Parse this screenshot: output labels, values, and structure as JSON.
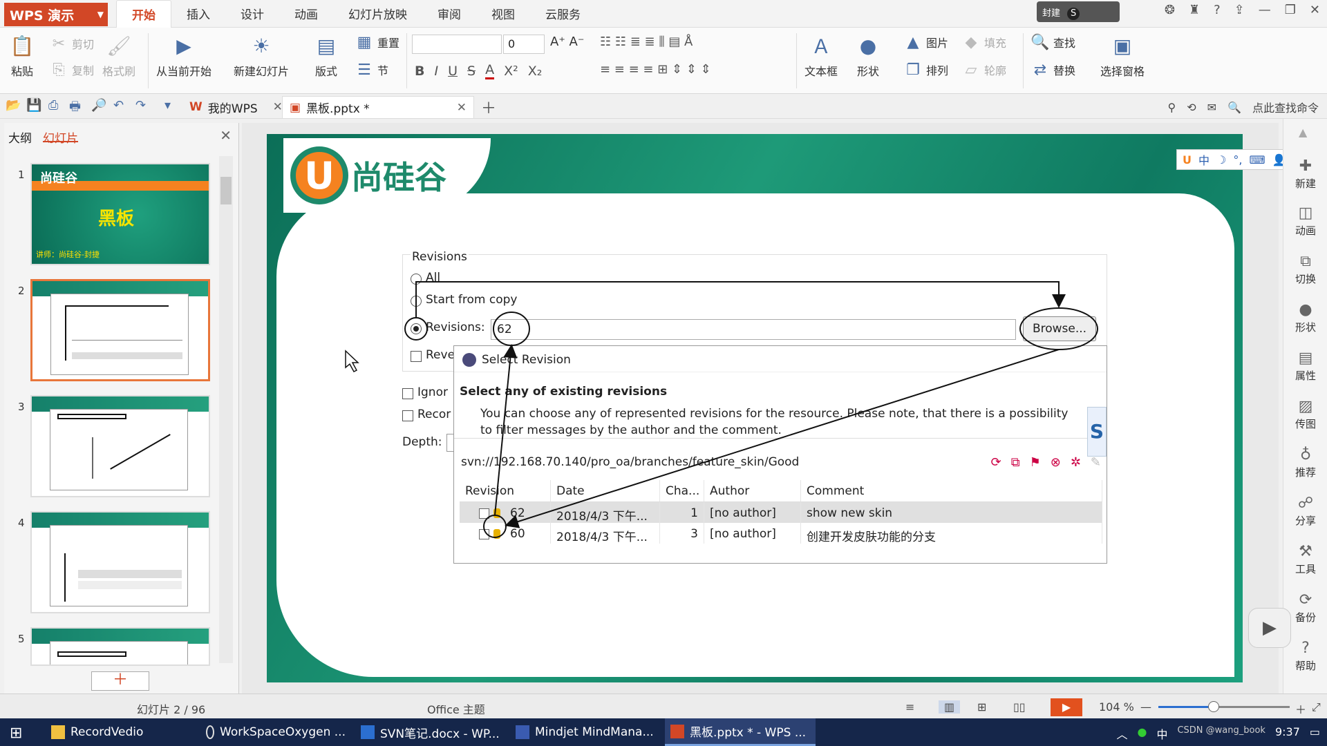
{
  "app": {
    "name": "WPS 演示",
    "user": "封建",
    "coin": "S"
  },
  "menu": {
    "tabs": [
      "开始",
      "插入",
      "设计",
      "动画",
      "幻灯片放映",
      "审阅",
      "视图",
      "云服务"
    ],
    "active": 0
  },
  "ribbon": {
    "paste": "粘贴",
    "cut": "剪切",
    "copy": "复制",
    "format_painter": "格式刷",
    "from_current": "从当前开始",
    "new_slide": "新建幻灯片",
    "layout": "版式",
    "reset": "重置",
    "section": "节",
    "font_size": "0",
    "textbox": "文本框",
    "shape": "形状",
    "picture": "图片",
    "fill": "填充",
    "arrange": "排列",
    "outline": "轮廓",
    "find": "查找",
    "replace": "替换",
    "select_pane": "选择窗格"
  },
  "doc_tabs": [
    {
      "label": "我的WPS",
      "active": false
    },
    {
      "label": "黑板.pptx *",
      "active": true
    }
  ],
  "quick_search": "点此查找命令",
  "left_panel": {
    "tab_outline": "大纲",
    "tab_slides": "幻灯片",
    "thumb_numbers": [
      "1",
      "2",
      "3",
      "4",
      "5"
    ],
    "thumb1": {
      "brand": "尚硅谷",
      "title": "黑板",
      "author": "讲师：尚硅谷-封捷"
    }
  },
  "slide": {
    "brand": "尚硅谷",
    "u": "U",
    "revisions_group": "Revisions",
    "opt_all": "All",
    "opt_start": "Start from copy",
    "opt_revisions": "Revisions:",
    "revisions_value": "62",
    "browse": "Browse...",
    "reve": "Reve",
    "ignor": "Ignor",
    "recor": "Recor",
    "depth": "Depth:",
    "select_revision": {
      "title": "Select Revision",
      "heading": "Select any of existing revisions",
      "desc1": "You can choose any of represented revisions for the resource. Please note, that there is a possibility",
      "desc2": "to filter messages by the author and the comment.",
      "badge": "S",
      "url": "svn://192.168.70.140/pro_oa/branches/feature_skin/Good",
      "columns": [
        "Revision",
        "Date",
        "Cha...",
        "Author",
        "Comment"
      ],
      "rows": [
        {
          "rev": "62",
          "date": "2018/4/3 下午...",
          "changes": "1",
          "author": "[no author]",
          "comment": "show new skin"
        },
        {
          "rev": "60",
          "date": "2018/4/3 下午...",
          "changes": "3",
          "author": "[no author]",
          "comment": "创建开发皮肤功能的分支"
        }
      ]
    }
  },
  "right_bar": [
    "新建",
    "动画",
    "切换",
    "形状",
    "属性",
    "传图",
    "推荐",
    "分享",
    "工具",
    "备份",
    "帮助"
  ],
  "status": {
    "slide_count": "幻灯片 2 / 96",
    "theme": "Office 主题",
    "zoom": "104 %",
    "zoom_level": 0.42
  },
  "taskbar": {
    "tasks": [
      "RecordVedio",
      "WorkSpaceOxygen ...",
      "SVN笔记.docx - WP...",
      "Mindjet MindMana...",
      "黑板.pptx * - WPS ..."
    ],
    "ime": "中",
    "clock": "9:37",
    "watermark": "CSDN @wang_book"
  }
}
